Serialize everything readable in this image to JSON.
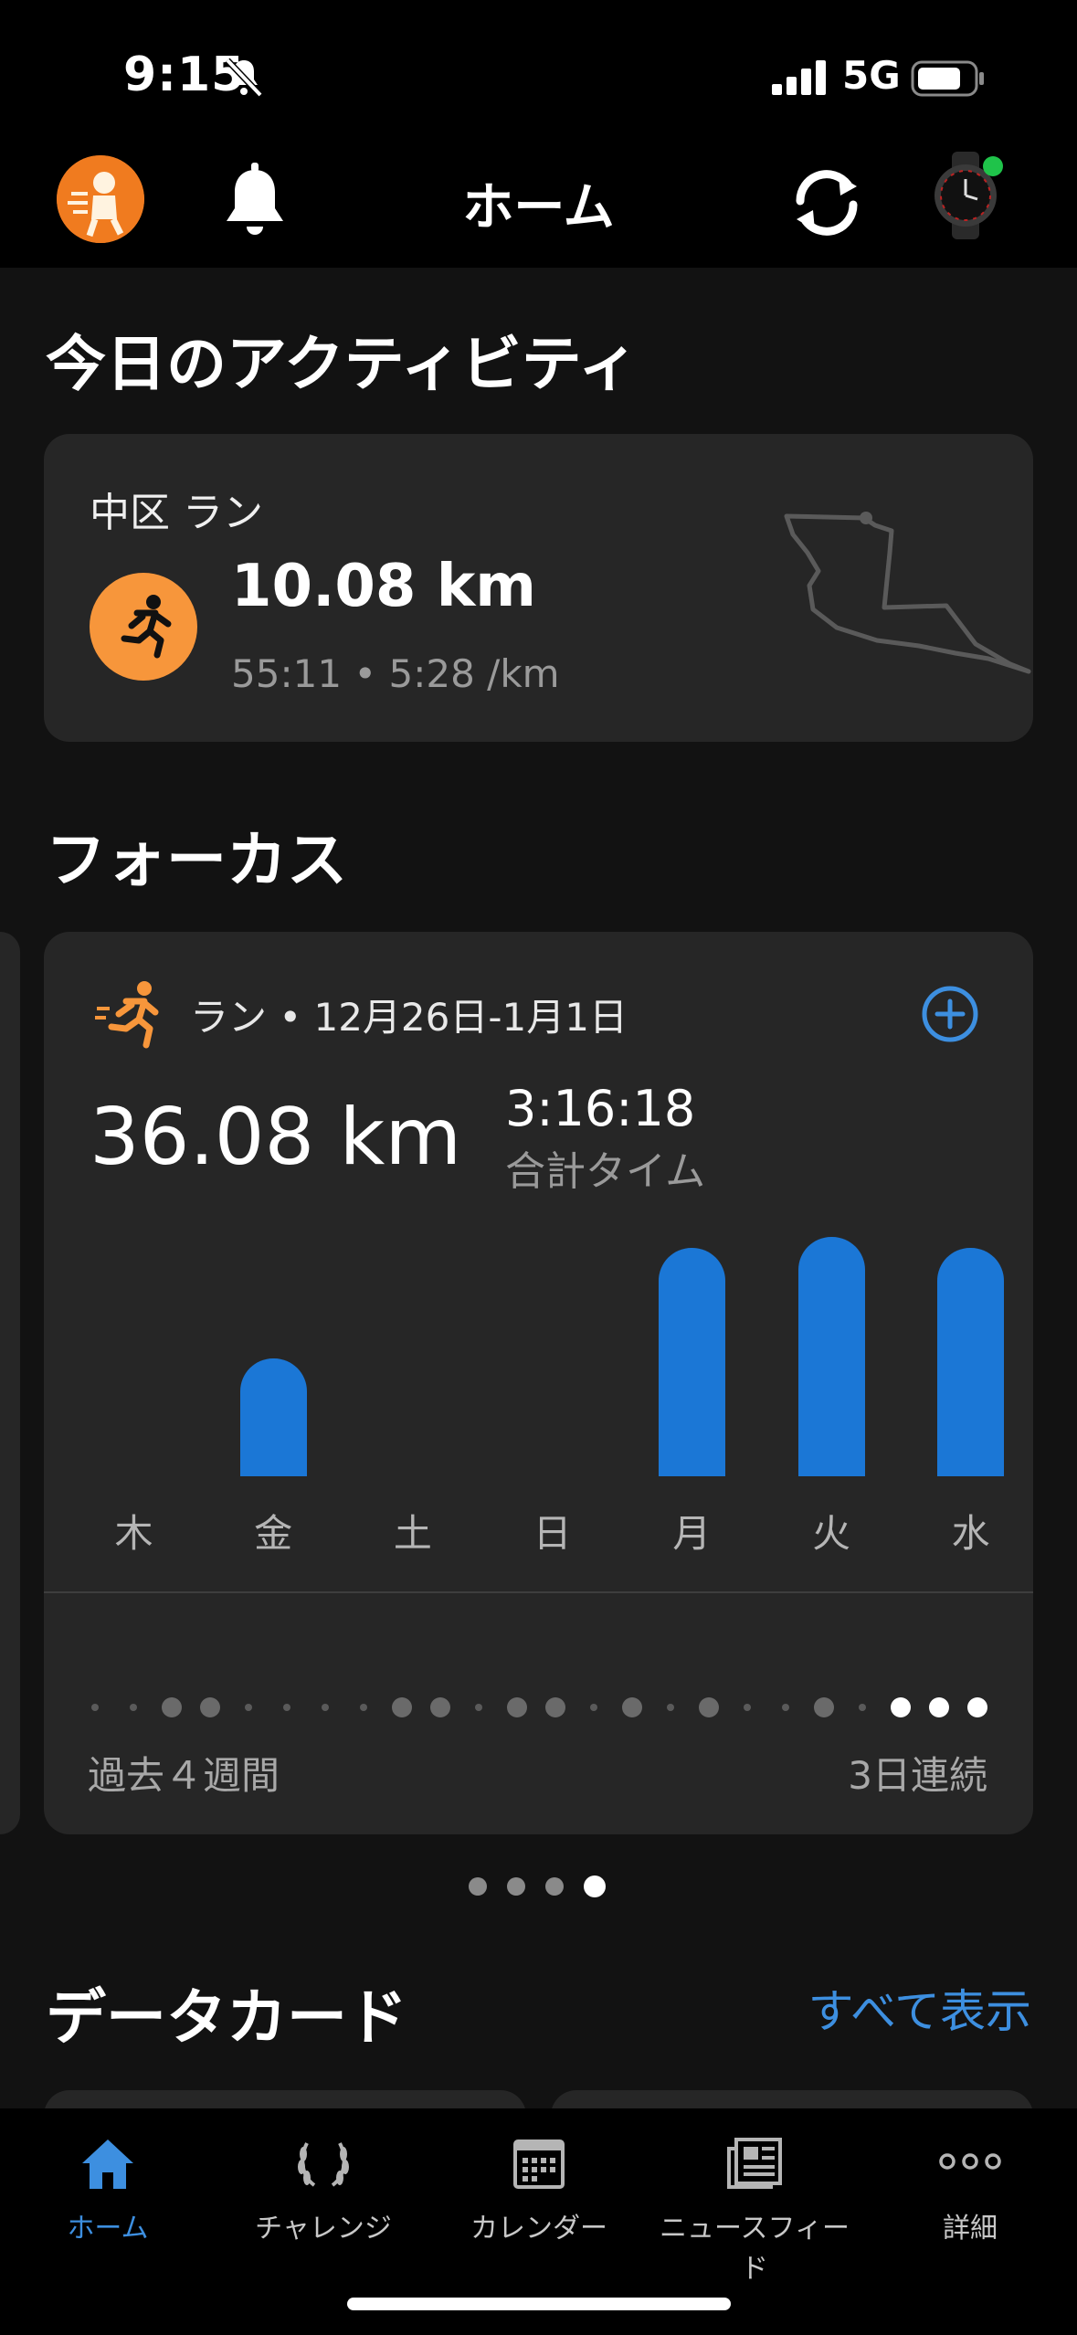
{
  "status": {
    "time": "9:15",
    "network": "5G"
  },
  "header": {
    "title": "ホーム"
  },
  "activity": {
    "section_title": "今日のアクティビティ",
    "name": "中区 ラン",
    "distance": "10.08 km",
    "detail": "55:11 • 5:28 /km"
  },
  "focus": {
    "section_title": "フォーカス",
    "heading": "ラン • 12月26日-1月1日",
    "total_distance": "36.08 km",
    "total_time": "3:16:18",
    "total_time_label": "合計タイム",
    "days": [
      {
        "label": "木",
        "value": 0
      },
      {
        "label": "金",
        "value": 5.2
      },
      {
        "label": "土",
        "value": 0
      },
      {
        "label": "日",
        "value": 0
      },
      {
        "label": "月",
        "value": 10.1
      },
      {
        "label": "火",
        "value": 10.6
      },
      {
        "label": "水",
        "value": 10.1
      }
    ],
    "streak_left": "過去４週間",
    "streak_right": "3日連続",
    "streak_pattern": [
      0,
      0,
      1,
      1,
      0,
      0,
      0,
      0,
      1,
      1,
      0,
      1,
      1,
      0,
      1,
      0,
      1,
      0,
      0,
      1,
      0,
      2,
      2,
      2
    ],
    "pager_count": 4,
    "pager_active": 3
  },
  "datacards": {
    "section_title": "データカード",
    "see_all": "すべて表示"
  },
  "tabs": [
    {
      "label": "ホーム",
      "icon": "home-icon",
      "active": true
    },
    {
      "label": "チャレンジ",
      "icon": "laurel-icon",
      "active": false
    },
    {
      "label": "カレンダー",
      "icon": "calendar-icon",
      "active": false
    },
    {
      "label": "ニュースフィード",
      "icon": "newsfeed-icon",
      "active": false
    },
    {
      "label": "詳細",
      "icon": "more-icon",
      "active": false
    }
  ],
  "colors": {
    "accent": "#1b77d6",
    "link": "#3d8fe0",
    "orange": "#f7963b"
  }
}
